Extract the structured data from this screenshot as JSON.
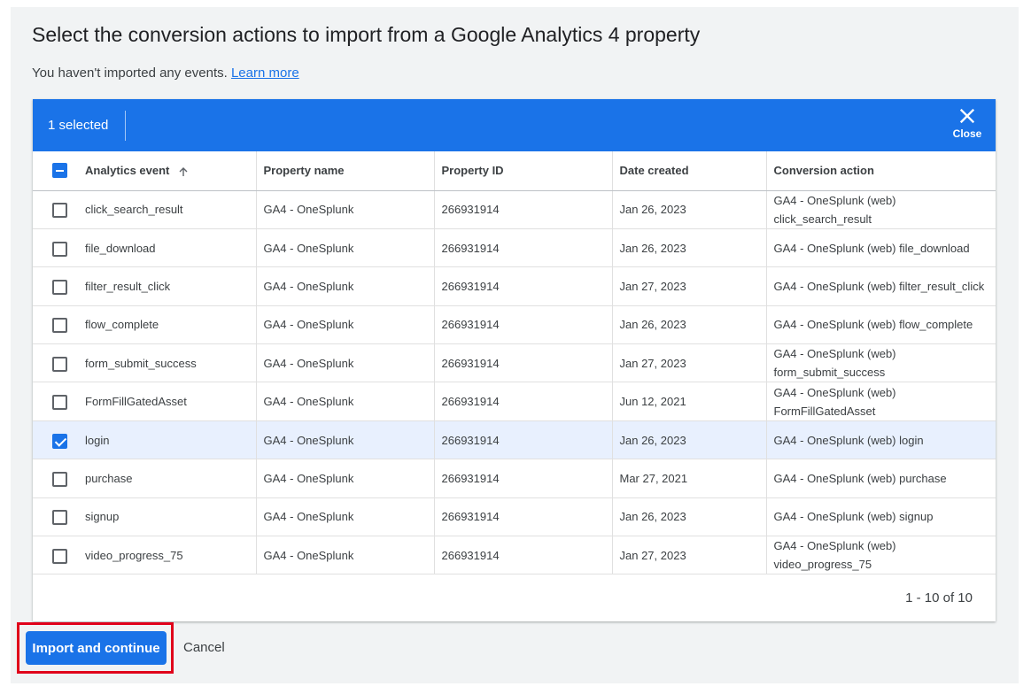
{
  "header": {
    "title": "Select the conversion actions to import from a Google Analytics 4 property",
    "subtitle": "You haven't imported any events.",
    "learn_more": "Learn more"
  },
  "selection_bar": {
    "count_label": "1 selected",
    "close_label": "Close"
  },
  "table": {
    "columns": [
      "Analytics event",
      "Property name",
      "Property ID",
      "Date created",
      "Conversion action"
    ],
    "rows": [
      {
        "event": "click_search_result",
        "property": "GA4 - OneSplunk",
        "id": "266931914",
        "date": "Jan 26, 2023",
        "action": "GA4 - OneSplunk (web) click_search_result",
        "checked": false
      },
      {
        "event": "file_download",
        "property": "GA4 - OneSplunk",
        "id": "266931914",
        "date": "Jan 26, 2023",
        "action": "GA4 - OneSplunk (web) file_download",
        "checked": false
      },
      {
        "event": "filter_result_click",
        "property": "GA4 - OneSplunk",
        "id": "266931914",
        "date": "Jan 27, 2023",
        "action": "GA4 - OneSplunk (web) filter_result_click",
        "checked": false
      },
      {
        "event": "flow_complete",
        "property": "GA4 - OneSplunk",
        "id": "266931914",
        "date": "Jan 26, 2023",
        "action": "GA4 - OneSplunk (web) flow_complete",
        "checked": false
      },
      {
        "event": "form_submit_success",
        "property": "GA4 - OneSplunk",
        "id": "266931914",
        "date": "Jan 27, 2023",
        "action": "GA4 - OneSplunk (web) form_submit_success",
        "checked": false
      },
      {
        "event": "FormFillGatedAsset",
        "property": "GA4 - OneSplunk",
        "id": "266931914",
        "date": "Jun 12, 2021",
        "action": "GA4 - OneSplunk (web) FormFillGatedAsset",
        "checked": false
      },
      {
        "event": "login",
        "property": "GA4 - OneSplunk",
        "id": "266931914",
        "date": "Jan 26, 2023",
        "action": "GA4 - OneSplunk (web) login",
        "checked": true
      },
      {
        "event": "purchase",
        "property": "GA4 - OneSplunk",
        "id": "266931914",
        "date": "Mar 27, 2021",
        "action": "GA4 - OneSplunk (web) purchase",
        "checked": false
      },
      {
        "event": "signup",
        "property": "GA4 - OneSplunk",
        "id": "266931914",
        "date": "Jan 26, 2023",
        "action": "GA4 - OneSplunk (web) signup",
        "checked": false
      },
      {
        "event": "video_progress_75",
        "property": "GA4 - OneSplunk",
        "id": "266931914",
        "date": "Jan 27, 2023",
        "action": "GA4 - OneSplunk (web) video_progress_75",
        "checked": false
      }
    ],
    "pagination": "1 - 10 of 10"
  },
  "actions": {
    "import_label": "Import and continue",
    "cancel_label": "Cancel"
  },
  "colors": {
    "primary": "#1a73e8",
    "selected_row": "#e8f0fe",
    "highlight_box": "#e0001a"
  },
  "icons": {
    "close": "close-icon",
    "sort": "arrow-up-icon",
    "header_checkbox": "indeterminate-checkbox-icon"
  }
}
